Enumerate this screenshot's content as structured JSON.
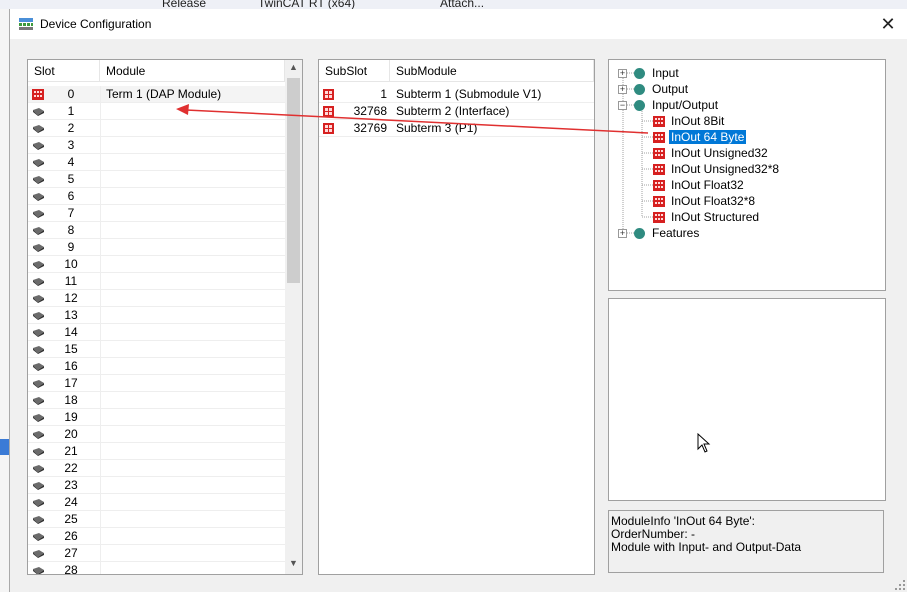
{
  "background": {
    "config_dropdown": "Release",
    "platform_dropdown": "TwinCAT RT (x64)",
    "attach_label": "Attach..."
  },
  "window": {
    "title": "Device Configuration",
    "close_glyph": "✕"
  },
  "slots": {
    "columns": {
      "slot": "Slot",
      "module": "Module"
    },
    "rows": [
      {
        "slot": "0",
        "module": "Term 1 (DAP Module)",
        "icon": "dap-module-icon"
      },
      {
        "slot": "1",
        "module": "",
        "icon": "empty-slot-icon"
      },
      {
        "slot": "2",
        "module": "",
        "icon": "empty-slot-icon"
      },
      {
        "slot": "3",
        "module": "",
        "icon": "empty-slot-icon"
      },
      {
        "slot": "4",
        "module": "",
        "icon": "empty-slot-icon"
      },
      {
        "slot": "5",
        "module": "",
        "icon": "empty-slot-icon"
      },
      {
        "slot": "6",
        "module": "",
        "icon": "empty-slot-icon"
      },
      {
        "slot": "7",
        "module": "",
        "icon": "empty-slot-icon"
      },
      {
        "slot": "8",
        "module": "",
        "icon": "empty-slot-icon"
      },
      {
        "slot": "9",
        "module": "",
        "icon": "empty-slot-icon"
      },
      {
        "slot": "10",
        "module": "",
        "icon": "empty-slot-icon"
      },
      {
        "slot": "11",
        "module": "",
        "icon": "empty-slot-icon"
      },
      {
        "slot": "12",
        "module": "",
        "icon": "empty-slot-icon"
      },
      {
        "slot": "13",
        "module": "",
        "icon": "empty-slot-icon"
      },
      {
        "slot": "14",
        "module": "",
        "icon": "empty-slot-icon"
      },
      {
        "slot": "15",
        "module": "",
        "icon": "empty-slot-icon"
      },
      {
        "slot": "16",
        "module": "",
        "icon": "empty-slot-icon"
      },
      {
        "slot": "17",
        "module": "",
        "icon": "empty-slot-icon"
      },
      {
        "slot": "18",
        "module": "",
        "icon": "empty-slot-icon"
      },
      {
        "slot": "19",
        "module": "",
        "icon": "empty-slot-icon"
      },
      {
        "slot": "20",
        "module": "",
        "icon": "empty-slot-icon"
      },
      {
        "slot": "21",
        "module": "",
        "icon": "empty-slot-icon"
      },
      {
        "slot": "22",
        "module": "",
        "icon": "empty-slot-icon"
      },
      {
        "slot": "23",
        "module": "",
        "icon": "empty-slot-icon"
      },
      {
        "slot": "24",
        "module": "",
        "icon": "empty-slot-icon"
      },
      {
        "slot": "25",
        "module": "",
        "icon": "empty-slot-icon"
      },
      {
        "slot": "26",
        "module": "",
        "icon": "empty-slot-icon"
      },
      {
        "slot": "27",
        "module": "",
        "icon": "empty-slot-icon"
      },
      {
        "slot": "28",
        "module": "",
        "icon": "empty-slot-icon"
      }
    ]
  },
  "subslots": {
    "columns": {
      "subslot": "SubSlot",
      "submodule": "SubModule"
    },
    "rows": [
      {
        "subslot": "1",
        "submodule": "Subterm 1 (Submodule V1)"
      },
      {
        "subslot": "32768",
        "submodule": "Subterm 2 (Interface)"
      },
      {
        "subslot": "32769",
        "submodule": "Subterm 3 (P1)"
      }
    ]
  },
  "tree": {
    "groups": [
      {
        "label": "Input",
        "expander": "+"
      },
      {
        "label": "Output",
        "expander": "+"
      },
      {
        "label": "Input/Output",
        "expander": "−"
      }
    ],
    "children": [
      {
        "label": "InOut 8Bit",
        "selected": false
      },
      {
        "label": "InOut 64 Byte",
        "selected": true
      },
      {
        "label": "InOut Unsigned32",
        "selected": false
      },
      {
        "label": "InOut Unsigned32*8",
        "selected": false
      },
      {
        "label": "InOut Float32",
        "selected": false
      },
      {
        "label": "InOut Float32*8",
        "selected": false
      },
      {
        "label": "InOut Structured",
        "selected": false
      }
    ],
    "last_group": {
      "label": "Features",
      "expander": "+"
    }
  },
  "module_info": {
    "line1": "ModuleInfo 'InOut 64 Byte':",
    "line2": "OrderNumber: -",
    "line3": "Module with Input- and Output-Data"
  },
  "colors": {
    "selection": "#0078d7",
    "drag_arrow": "#e03030",
    "node": "#2f8b80",
    "module_icon": "#d62020"
  }
}
